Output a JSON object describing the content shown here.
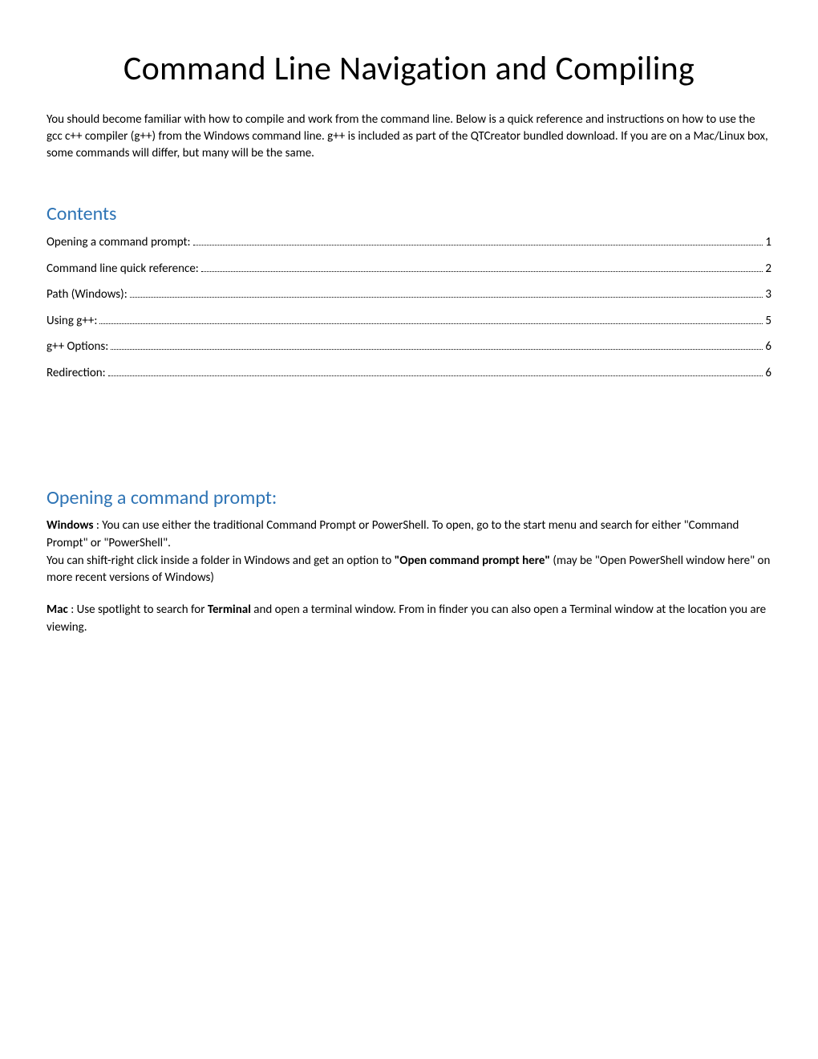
{
  "title": "Command Line Navigation and Compiling",
  "intro": "You should become familiar with how to compile and work from the command line. Below is a quick reference and instructions on how to use the gcc c++ compiler (g++) from the Windows command line. g++ is included as part of the QTCreator bundled download. If you are on a Mac/Linux box, some commands will differ, but many will be the same.",
  "contents_heading": "Contents",
  "toc": [
    {
      "label": "Opening a command prompt:",
      "page": "1"
    },
    {
      "label": "Command line quick reference:",
      "page": "2"
    },
    {
      "label": "Path (Windows):",
      "page": "3"
    },
    {
      "label": "Using g++:",
      "page": "5"
    },
    {
      "label": "g++ Options:",
      "page": "6"
    },
    {
      "label": "Redirection:",
      "page": "6"
    }
  ],
  "section1_heading": "Opening a command prompt:",
  "windows_label": "Windows",
  "windows_text1": " : You can use either the traditional Command Prompt or PowerShell. To open, go to the start menu and search for either \"Command Prompt\" or \"PowerShell\".",
  "windows_text2a": "You can shift-right click inside a folder in Windows and get an option to ",
  "windows_text2b": "\"Open command prompt here\"",
  "windows_text2c": " (may be \"Open PowerShell window here\" on more recent versions of Windows)",
  "mac_label": "Mac",
  "mac_text1": " : Use spotlight to search for ",
  "mac_terminal": "Terminal",
  "mac_text2": " and open a terminal window. From in finder you can also open a Terminal window at the location you are viewing."
}
